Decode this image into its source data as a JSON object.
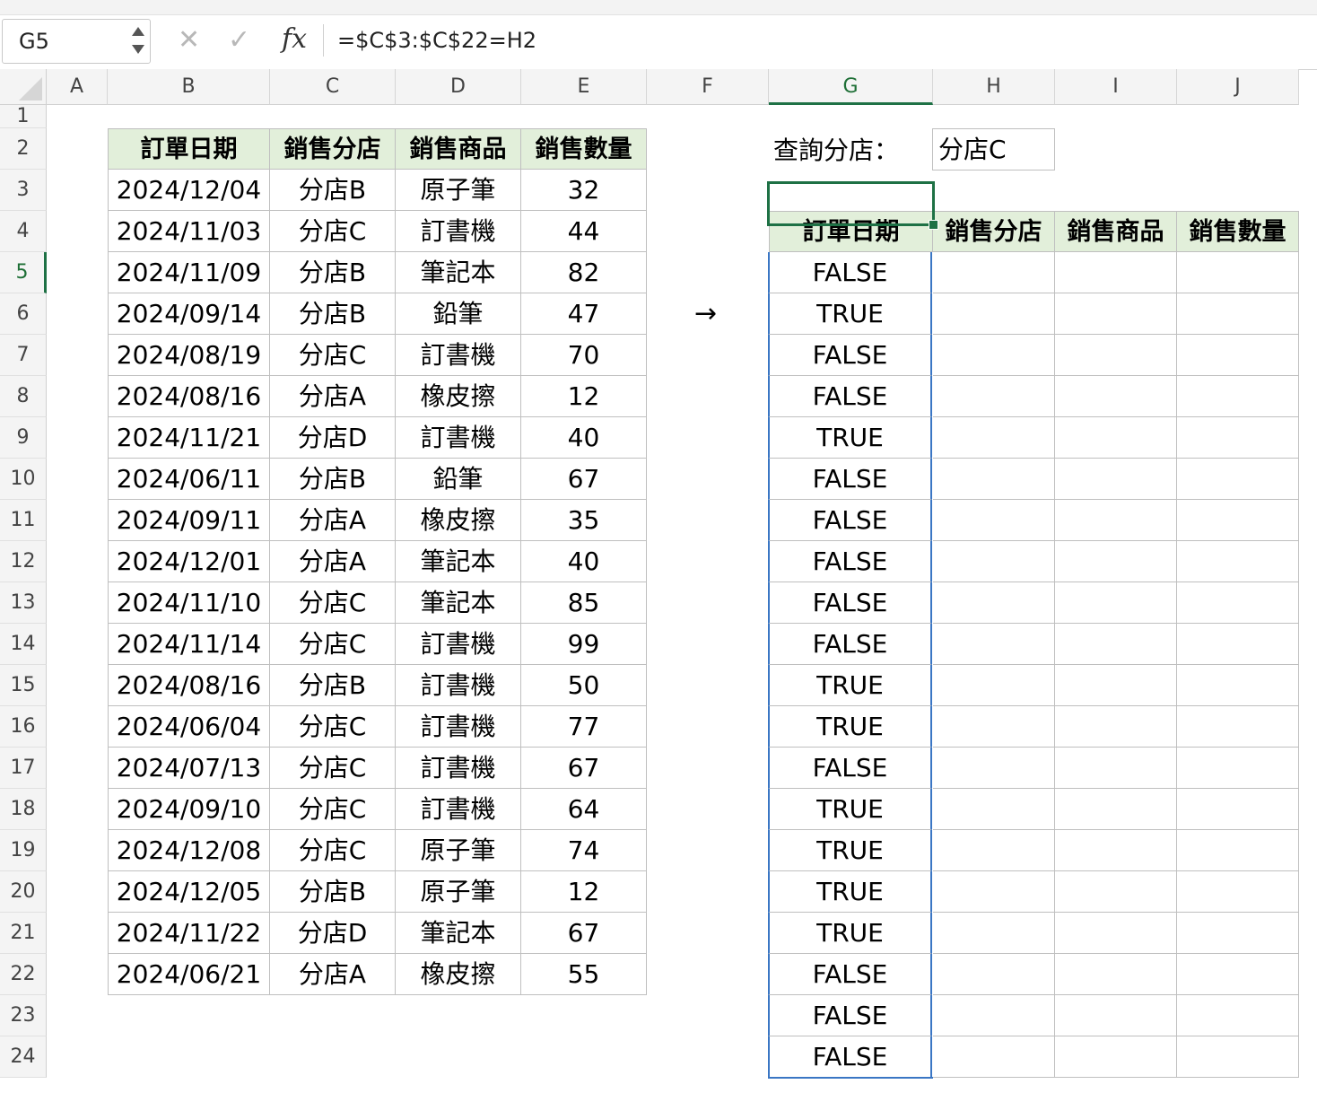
{
  "formula_bar": {
    "name_box": "G5",
    "cancel_icon": "✕",
    "enter_icon": "✓",
    "fx_label": "fx",
    "formula": "=$C$3:$C$22=H2"
  },
  "columns": [
    "A",
    "B",
    "C",
    "D",
    "E",
    "F",
    "G",
    "H",
    "I",
    "J"
  ],
  "rows": [
    "1",
    "2",
    "3",
    "4",
    "5",
    "6",
    "7",
    "8",
    "9",
    "10",
    "11",
    "12",
    "13",
    "14",
    "15",
    "16",
    "17",
    "18",
    "19",
    "20",
    "21",
    "22",
    "23",
    "24"
  ],
  "source_table": {
    "headers": [
      "訂單日期",
      "銷售分店",
      "銷售商品",
      "銷售數量"
    ],
    "rows": [
      [
        "2024/12/04",
        "分店B",
        "原子筆",
        "32"
      ],
      [
        "2024/11/03",
        "分店C",
        "訂書機",
        "44"
      ],
      [
        "2024/11/09",
        "分店B",
        "筆記本",
        "82"
      ],
      [
        "2024/09/14",
        "分店B",
        "鉛筆",
        "47"
      ],
      [
        "2024/08/19",
        "分店C",
        "訂書機",
        "70"
      ],
      [
        "2024/08/16",
        "分店A",
        "橡皮擦",
        "12"
      ],
      [
        "2024/11/21",
        "分店D",
        "訂書機",
        "40"
      ],
      [
        "2024/06/11",
        "分店B",
        "鉛筆",
        "67"
      ],
      [
        "2024/09/11",
        "分店A",
        "橡皮擦",
        "35"
      ],
      [
        "2024/12/01",
        "分店A",
        "筆記本",
        "40"
      ],
      [
        "2024/11/10",
        "分店C",
        "筆記本",
        "85"
      ],
      [
        "2024/11/14",
        "分店C",
        "訂書機",
        "99"
      ],
      [
        "2024/08/16",
        "分店B",
        "訂書機",
        "50"
      ],
      [
        "2024/06/04",
        "分店C",
        "訂書機",
        "77"
      ],
      [
        "2024/07/13",
        "分店C",
        "訂書機",
        "67"
      ],
      [
        "2024/09/10",
        "分店C",
        "訂書機",
        "64"
      ],
      [
        "2024/12/08",
        "分店C",
        "原子筆",
        "74"
      ],
      [
        "2024/12/05",
        "分店B",
        "原子筆",
        "12"
      ],
      [
        "2024/11/22",
        "分店D",
        "筆記本",
        "67"
      ],
      [
        "2024/06/21",
        "分店A",
        "橡皮擦",
        "55"
      ]
    ]
  },
  "lookup": {
    "label": "查詢分店：",
    "value": "分店C"
  },
  "arrow": "→",
  "result_table": {
    "headers": [
      "訂單日期",
      "銷售分店",
      "銷售商品",
      "銷售數量"
    ],
    "g_values": [
      "FALSE",
      "TRUE",
      "FALSE",
      "FALSE",
      "TRUE",
      "FALSE",
      "FALSE",
      "FALSE",
      "FALSE",
      "FALSE",
      "TRUE",
      "TRUE",
      "FALSE",
      "TRUE",
      "TRUE",
      "TRUE",
      "TRUE",
      "FALSE",
      "FALSE",
      "FALSE"
    ]
  },
  "colors": {
    "header_fill": "#e2efda",
    "selection": "#1e7145",
    "spill_border": "#3a76c4"
  }
}
